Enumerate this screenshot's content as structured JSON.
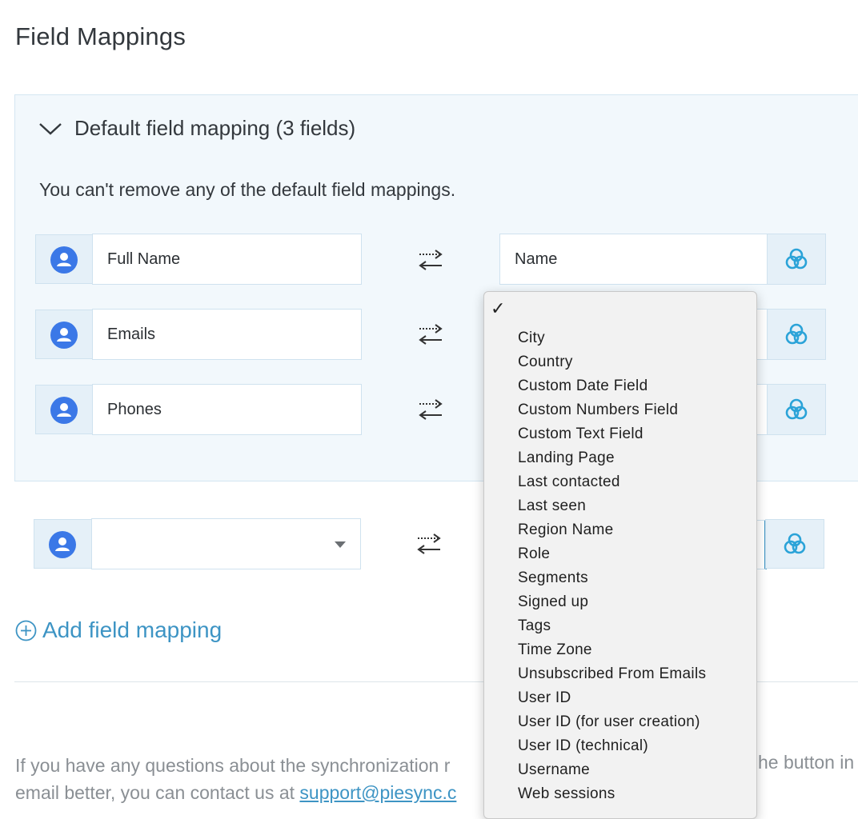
{
  "page": {
    "title": "Field Mappings"
  },
  "panel": {
    "title": "Default field mapping (3 fields)",
    "note": "You can't remove any of the default field mappings."
  },
  "mappings": [
    {
      "source": "Full Name",
      "target": "Name"
    },
    {
      "source": "Emails",
      "target": ""
    },
    {
      "source": "Phones",
      "target": ""
    }
  ],
  "new_mapping": {
    "source": "",
    "target": ""
  },
  "add_mapping": {
    "label": "Add field mapping"
  },
  "help": {
    "line1": "If you have any questions about the synchronization r",
    "line1_end": "he button in",
    "line2_prefix": "email better, you can contact us at ",
    "email": "support@piesync.c"
  },
  "dropdown": {
    "check": "✓",
    "options": [
      "City",
      "Country",
      "Custom Date Field",
      "Custom Numbers Field",
      "Custom Text Field",
      "Landing Page",
      "Last contacted",
      "Last seen",
      "Region Name",
      "Role",
      "Segments",
      "Signed up",
      "Tags",
      "Time Zone",
      "Unsubscribed From Emails",
      "User ID",
      "User ID (for user creation)",
      "User ID (technical)",
      "Username",
      "Web sessions"
    ]
  },
  "colors": {
    "accent": "#3d94c4",
    "google_blue": "#3b78e7",
    "app_blue": "#2ba3d8"
  }
}
